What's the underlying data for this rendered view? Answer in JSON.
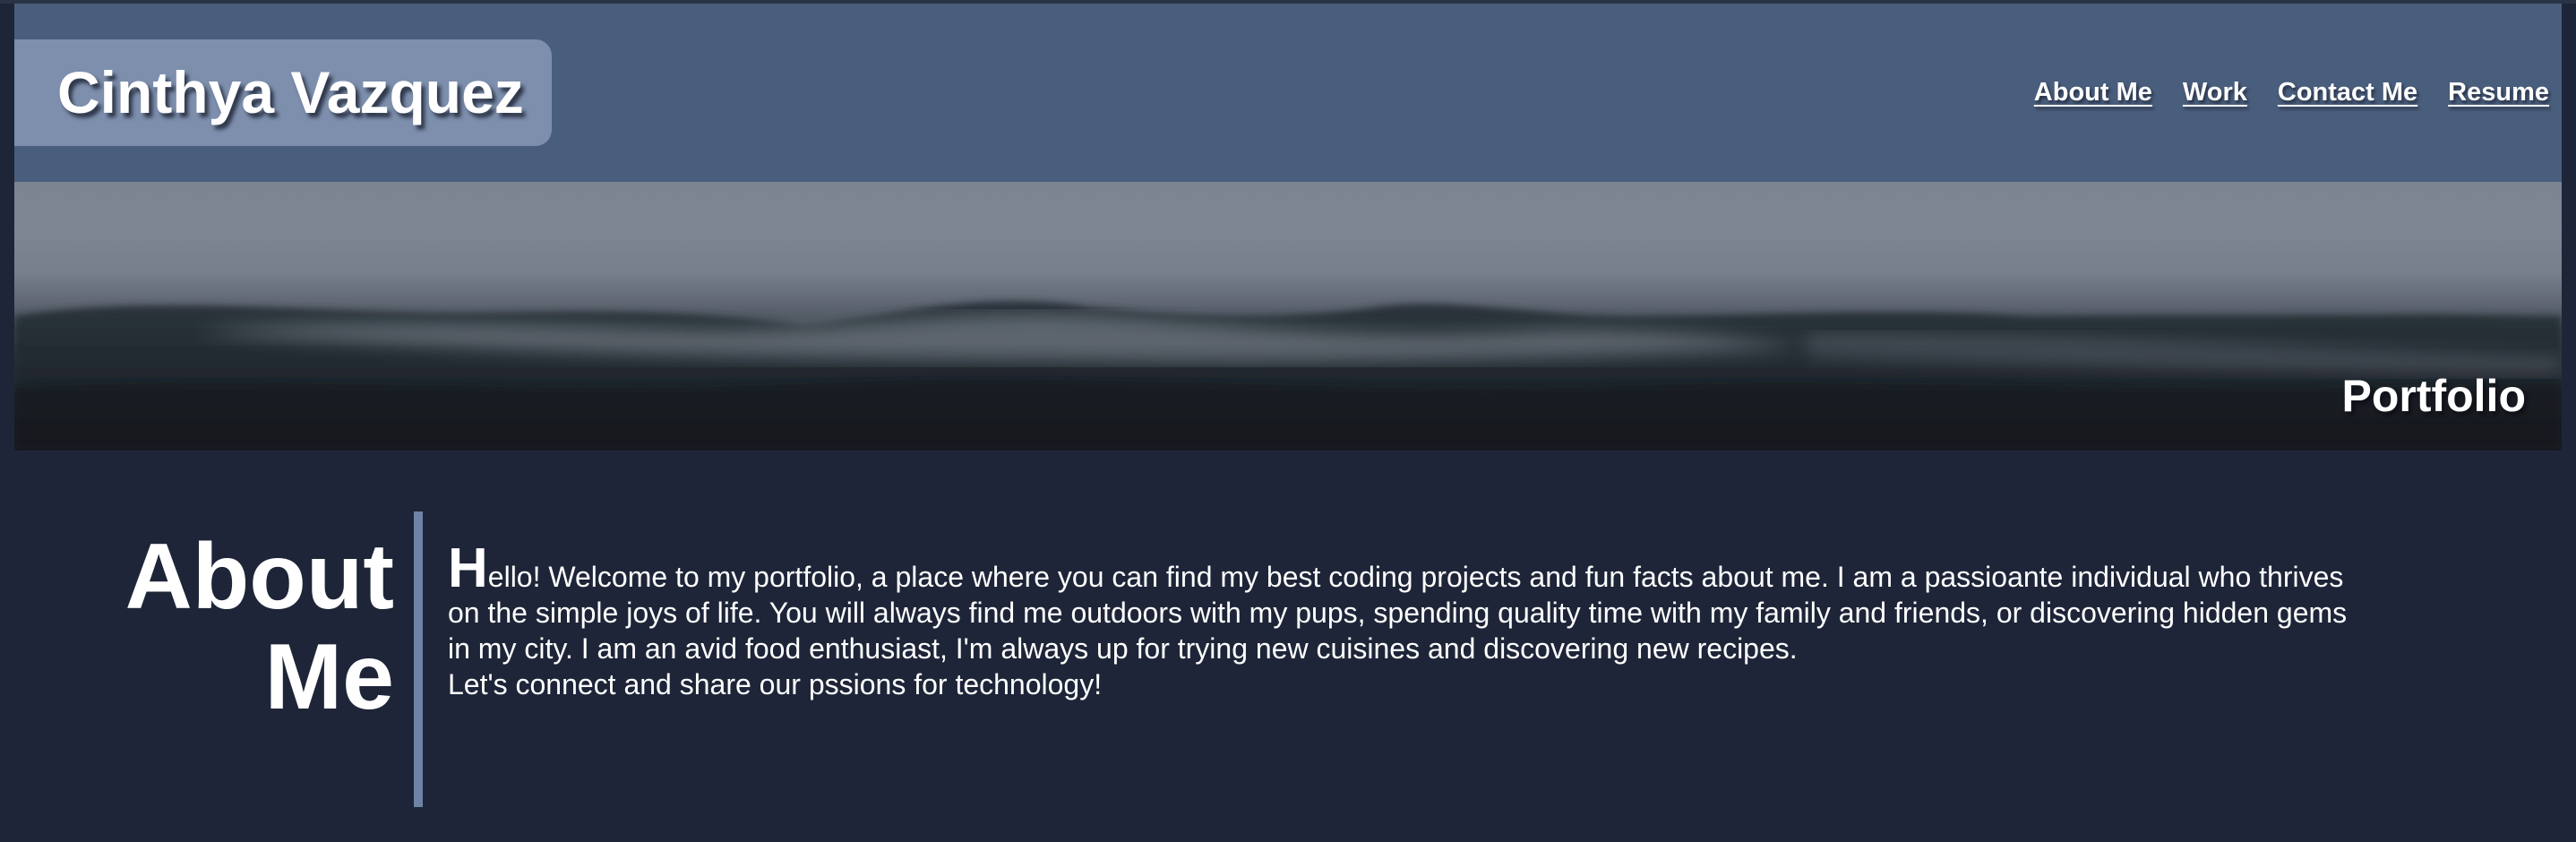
{
  "header": {
    "name": "Cinthya Vazquez",
    "nav": [
      "About Me",
      "Work",
      "Contact Me",
      "Resume"
    ]
  },
  "hero": {
    "label": "Portfolio",
    "image": "foggy-mountain-landscape"
  },
  "about": {
    "title_line1": "About",
    "title_line2": "Me",
    "dropcap": "H",
    "paragraph1": "ello! Welcome to my portfolio, a place where you can find my best coding projects and fun facts about me. I am a passioante individual who thrives on the simple joys of life. You will always find me outdoors with my pups, spending quality time with my family and friends, or discovering hidden gems in my city. I am an avid food enthusiast, I'm always up for trying new cuisines and discovering new recipes.",
    "paragraph2": "Let's connect and share our pssions for technology!"
  },
  "colors": {
    "background": "#1e2538",
    "header": "#495d7c",
    "name_badge": "#7d8fad",
    "divider": "#6f83a6",
    "text": "#ffffff"
  }
}
